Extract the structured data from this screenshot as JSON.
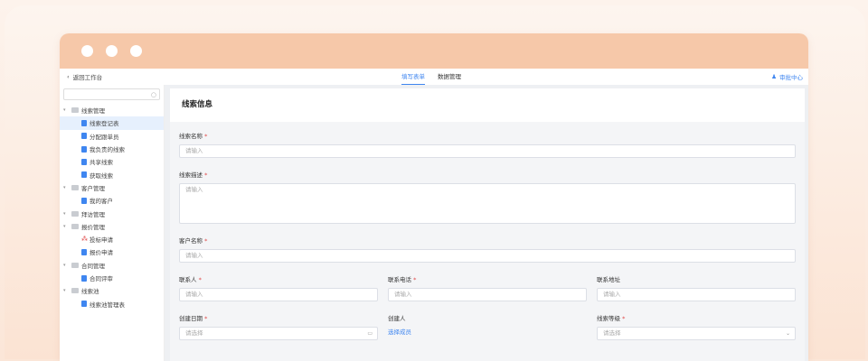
{
  "topbar": {
    "back_label": "返回工作台",
    "tabs": [
      {
        "label": "填写表单",
        "active": true
      },
      {
        "label": "数据管理",
        "active": false
      }
    ],
    "approve_label": "审批中心"
  },
  "sidebar": {
    "search_placeholder": "",
    "items": [
      {
        "type": "group",
        "label": "线索管理"
      },
      {
        "type": "leaf",
        "label": "线索登记表",
        "selected": true
      },
      {
        "type": "leaf",
        "label": "分配跟单员"
      },
      {
        "type": "leaf",
        "label": "我负责的线索"
      },
      {
        "type": "leaf",
        "label": "共享线索"
      },
      {
        "type": "leaf",
        "label": "获取线索"
      },
      {
        "type": "group",
        "label": "客户管理"
      },
      {
        "type": "leaf",
        "label": "我的客户"
      },
      {
        "type": "group",
        "label": "拜访管理"
      },
      {
        "type": "group",
        "label": "报价管理"
      },
      {
        "type": "leaf",
        "label": "投标申请",
        "icon": "flow"
      },
      {
        "type": "leaf",
        "label": "报价申请"
      },
      {
        "type": "group",
        "label": "合同管理"
      },
      {
        "type": "leaf",
        "label": "合同评审"
      },
      {
        "type": "group",
        "label": "线索池"
      },
      {
        "type": "leaf",
        "label": "线索池管理表"
      }
    ]
  },
  "form": {
    "title": "线索信息",
    "clue_name": {
      "label": "线索名称",
      "placeholder": "请输入"
    },
    "clue_desc": {
      "label": "线索描述",
      "placeholder": "请输入"
    },
    "customer_name": {
      "label": "客户名称",
      "placeholder": "请输入"
    },
    "contact": {
      "label": "联系人",
      "placeholder": "请输入"
    },
    "phone": {
      "label": "联系电话",
      "placeholder": "请输入"
    },
    "address": {
      "label": "联系地址",
      "placeholder": "请输入"
    },
    "create_date": {
      "label": "创建日期",
      "placeholder": "请选择"
    },
    "creator": {
      "label": "创建人",
      "link": "选择成员"
    },
    "level": {
      "label": "线索等级",
      "placeholder": "请选择"
    }
  },
  "colors": {
    "accent": "#3f86f0",
    "required": "#e04848",
    "titlebar": "#f6c8a9"
  }
}
